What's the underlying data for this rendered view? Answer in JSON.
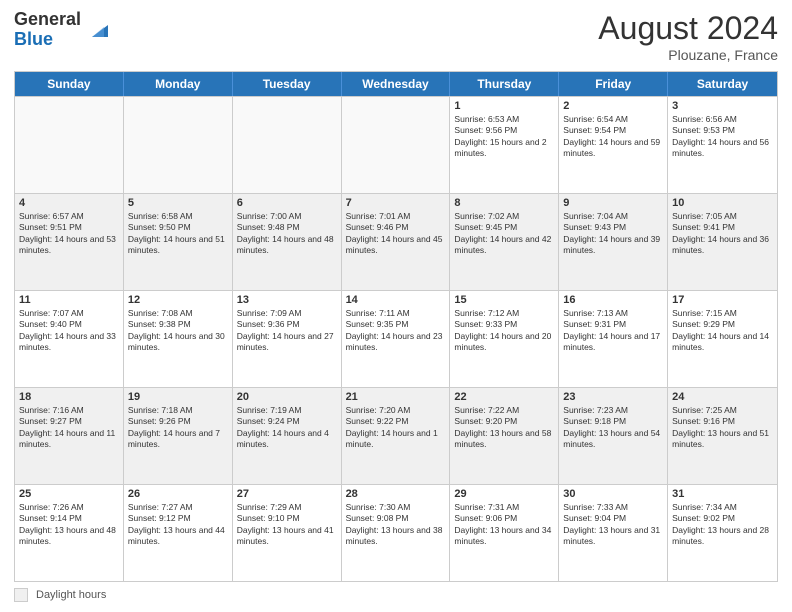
{
  "header": {
    "logo_general": "General",
    "logo_blue": "Blue",
    "month_year": "August 2024",
    "location": "Plouzane, France"
  },
  "days_of_week": [
    "Sunday",
    "Monday",
    "Tuesday",
    "Wednesday",
    "Thursday",
    "Friday",
    "Saturday"
  ],
  "weeks": [
    [
      {
        "day": "",
        "sunrise": "",
        "sunset": "",
        "daylight": "",
        "empty": true
      },
      {
        "day": "",
        "sunrise": "",
        "sunset": "",
        "daylight": "",
        "empty": true
      },
      {
        "day": "",
        "sunrise": "",
        "sunset": "",
        "daylight": "",
        "empty": true
      },
      {
        "day": "",
        "sunrise": "",
        "sunset": "",
        "daylight": "",
        "empty": true
      },
      {
        "day": "1",
        "sunrise": "Sunrise: 6:53 AM",
        "sunset": "Sunset: 9:56 PM",
        "daylight": "Daylight: 15 hours and 2 minutes."
      },
      {
        "day": "2",
        "sunrise": "Sunrise: 6:54 AM",
        "sunset": "Sunset: 9:54 PM",
        "daylight": "Daylight: 14 hours and 59 minutes."
      },
      {
        "day": "3",
        "sunrise": "Sunrise: 6:56 AM",
        "sunset": "Sunset: 9:53 PM",
        "daylight": "Daylight: 14 hours and 56 minutes."
      }
    ],
    [
      {
        "day": "4",
        "sunrise": "Sunrise: 6:57 AM",
        "sunset": "Sunset: 9:51 PM",
        "daylight": "Daylight: 14 hours and 53 minutes."
      },
      {
        "day": "5",
        "sunrise": "Sunrise: 6:58 AM",
        "sunset": "Sunset: 9:50 PM",
        "daylight": "Daylight: 14 hours and 51 minutes."
      },
      {
        "day": "6",
        "sunrise": "Sunrise: 7:00 AM",
        "sunset": "Sunset: 9:48 PM",
        "daylight": "Daylight: 14 hours and 48 minutes."
      },
      {
        "day": "7",
        "sunrise": "Sunrise: 7:01 AM",
        "sunset": "Sunset: 9:46 PM",
        "daylight": "Daylight: 14 hours and 45 minutes."
      },
      {
        "day": "8",
        "sunrise": "Sunrise: 7:02 AM",
        "sunset": "Sunset: 9:45 PM",
        "daylight": "Daylight: 14 hours and 42 minutes."
      },
      {
        "day": "9",
        "sunrise": "Sunrise: 7:04 AM",
        "sunset": "Sunset: 9:43 PM",
        "daylight": "Daylight: 14 hours and 39 minutes."
      },
      {
        "day": "10",
        "sunrise": "Sunrise: 7:05 AM",
        "sunset": "Sunset: 9:41 PM",
        "daylight": "Daylight: 14 hours and 36 minutes."
      }
    ],
    [
      {
        "day": "11",
        "sunrise": "Sunrise: 7:07 AM",
        "sunset": "Sunset: 9:40 PM",
        "daylight": "Daylight: 14 hours and 33 minutes."
      },
      {
        "day": "12",
        "sunrise": "Sunrise: 7:08 AM",
        "sunset": "Sunset: 9:38 PM",
        "daylight": "Daylight: 14 hours and 30 minutes."
      },
      {
        "day": "13",
        "sunrise": "Sunrise: 7:09 AM",
        "sunset": "Sunset: 9:36 PM",
        "daylight": "Daylight: 14 hours and 27 minutes."
      },
      {
        "day": "14",
        "sunrise": "Sunrise: 7:11 AM",
        "sunset": "Sunset: 9:35 PM",
        "daylight": "Daylight: 14 hours and 23 minutes."
      },
      {
        "day": "15",
        "sunrise": "Sunrise: 7:12 AM",
        "sunset": "Sunset: 9:33 PM",
        "daylight": "Daylight: 14 hours and 20 minutes."
      },
      {
        "day": "16",
        "sunrise": "Sunrise: 7:13 AM",
        "sunset": "Sunset: 9:31 PM",
        "daylight": "Daylight: 14 hours and 17 minutes."
      },
      {
        "day": "17",
        "sunrise": "Sunrise: 7:15 AM",
        "sunset": "Sunset: 9:29 PM",
        "daylight": "Daylight: 14 hours and 14 minutes."
      }
    ],
    [
      {
        "day": "18",
        "sunrise": "Sunrise: 7:16 AM",
        "sunset": "Sunset: 9:27 PM",
        "daylight": "Daylight: 14 hours and 11 minutes."
      },
      {
        "day": "19",
        "sunrise": "Sunrise: 7:18 AM",
        "sunset": "Sunset: 9:26 PM",
        "daylight": "Daylight: 14 hours and 7 minutes."
      },
      {
        "day": "20",
        "sunrise": "Sunrise: 7:19 AM",
        "sunset": "Sunset: 9:24 PM",
        "daylight": "Daylight: 14 hours and 4 minutes."
      },
      {
        "day": "21",
        "sunrise": "Sunrise: 7:20 AM",
        "sunset": "Sunset: 9:22 PM",
        "daylight": "Daylight: 14 hours and 1 minute."
      },
      {
        "day": "22",
        "sunrise": "Sunrise: 7:22 AM",
        "sunset": "Sunset: 9:20 PM",
        "daylight": "Daylight: 13 hours and 58 minutes."
      },
      {
        "day": "23",
        "sunrise": "Sunrise: 7:23 AM",
        "sunset": "Sunset: 9:18 PM",
        "daylight": "Daylight: 13 hours and 54 minutes."
      },
      {
        "day": "24",
        "sunrise": "Sunrise: 7:25 AM",
        "sunset": "Sunset: 9:16 PM",
        "daylight": "Daylight: 13 hours and 51 minutes."
      }
    ],
    [
      {
        "day": "25",
        "sunrise": "Sunrise: 7:26 AM",
        "sunset": "Sunset: 9:14 PM",
        "daylight": "Daylight: 13 hours and 48 minutes."
      },
      {
        "day": "26",
        "sunrise": "Sunrise: 7:27 AM",
        "sunset": "Sunset: 9:12 PM",
        "daylight": "Daylight: 13 hours and 44 minutes."
      },
      {
        "day": "27",
        "sunrise": "Sunrise: 7:29 AM",
        "sunset": "Sunset: 9:10 PM",
        "daylight": "Daylight: 13 hours and 41 minutes."
      },
      {
        "day": "28",
        "sunrise": "Sunrise: 7:30 AM",
        "sunset": "Sunset: 9:08 PM",
        "daylight": "Daylight: 13 hours and 38 minutes."
      },
      {
        "day": "29",
        "sunrise": "Sunrise: 7:31 AM",
        "sunset": "Sunset: 9:06 PM",
        "daylight": "Daylight: 13 hours and 34 minutes."
      },
      {
        "day": "30",
        "sunrise": "Sunrise: 7:33 AM",
        "sunset": "Sunset: 9:04 PM",
        "daylight": "Daylight: 13 hours and 31 minutes."
      },
      {
        "day": "31",
        "sunrise": "Sunrise: 7:34 AM",
        "sunset": "Sunset: 9:02 PM",
        "daylight": "Daylight: 13 hours and 28 minutes."
      }
    ]
  ],
  "footer": {
    "legend_label": "Daylight hours"
  }
}
